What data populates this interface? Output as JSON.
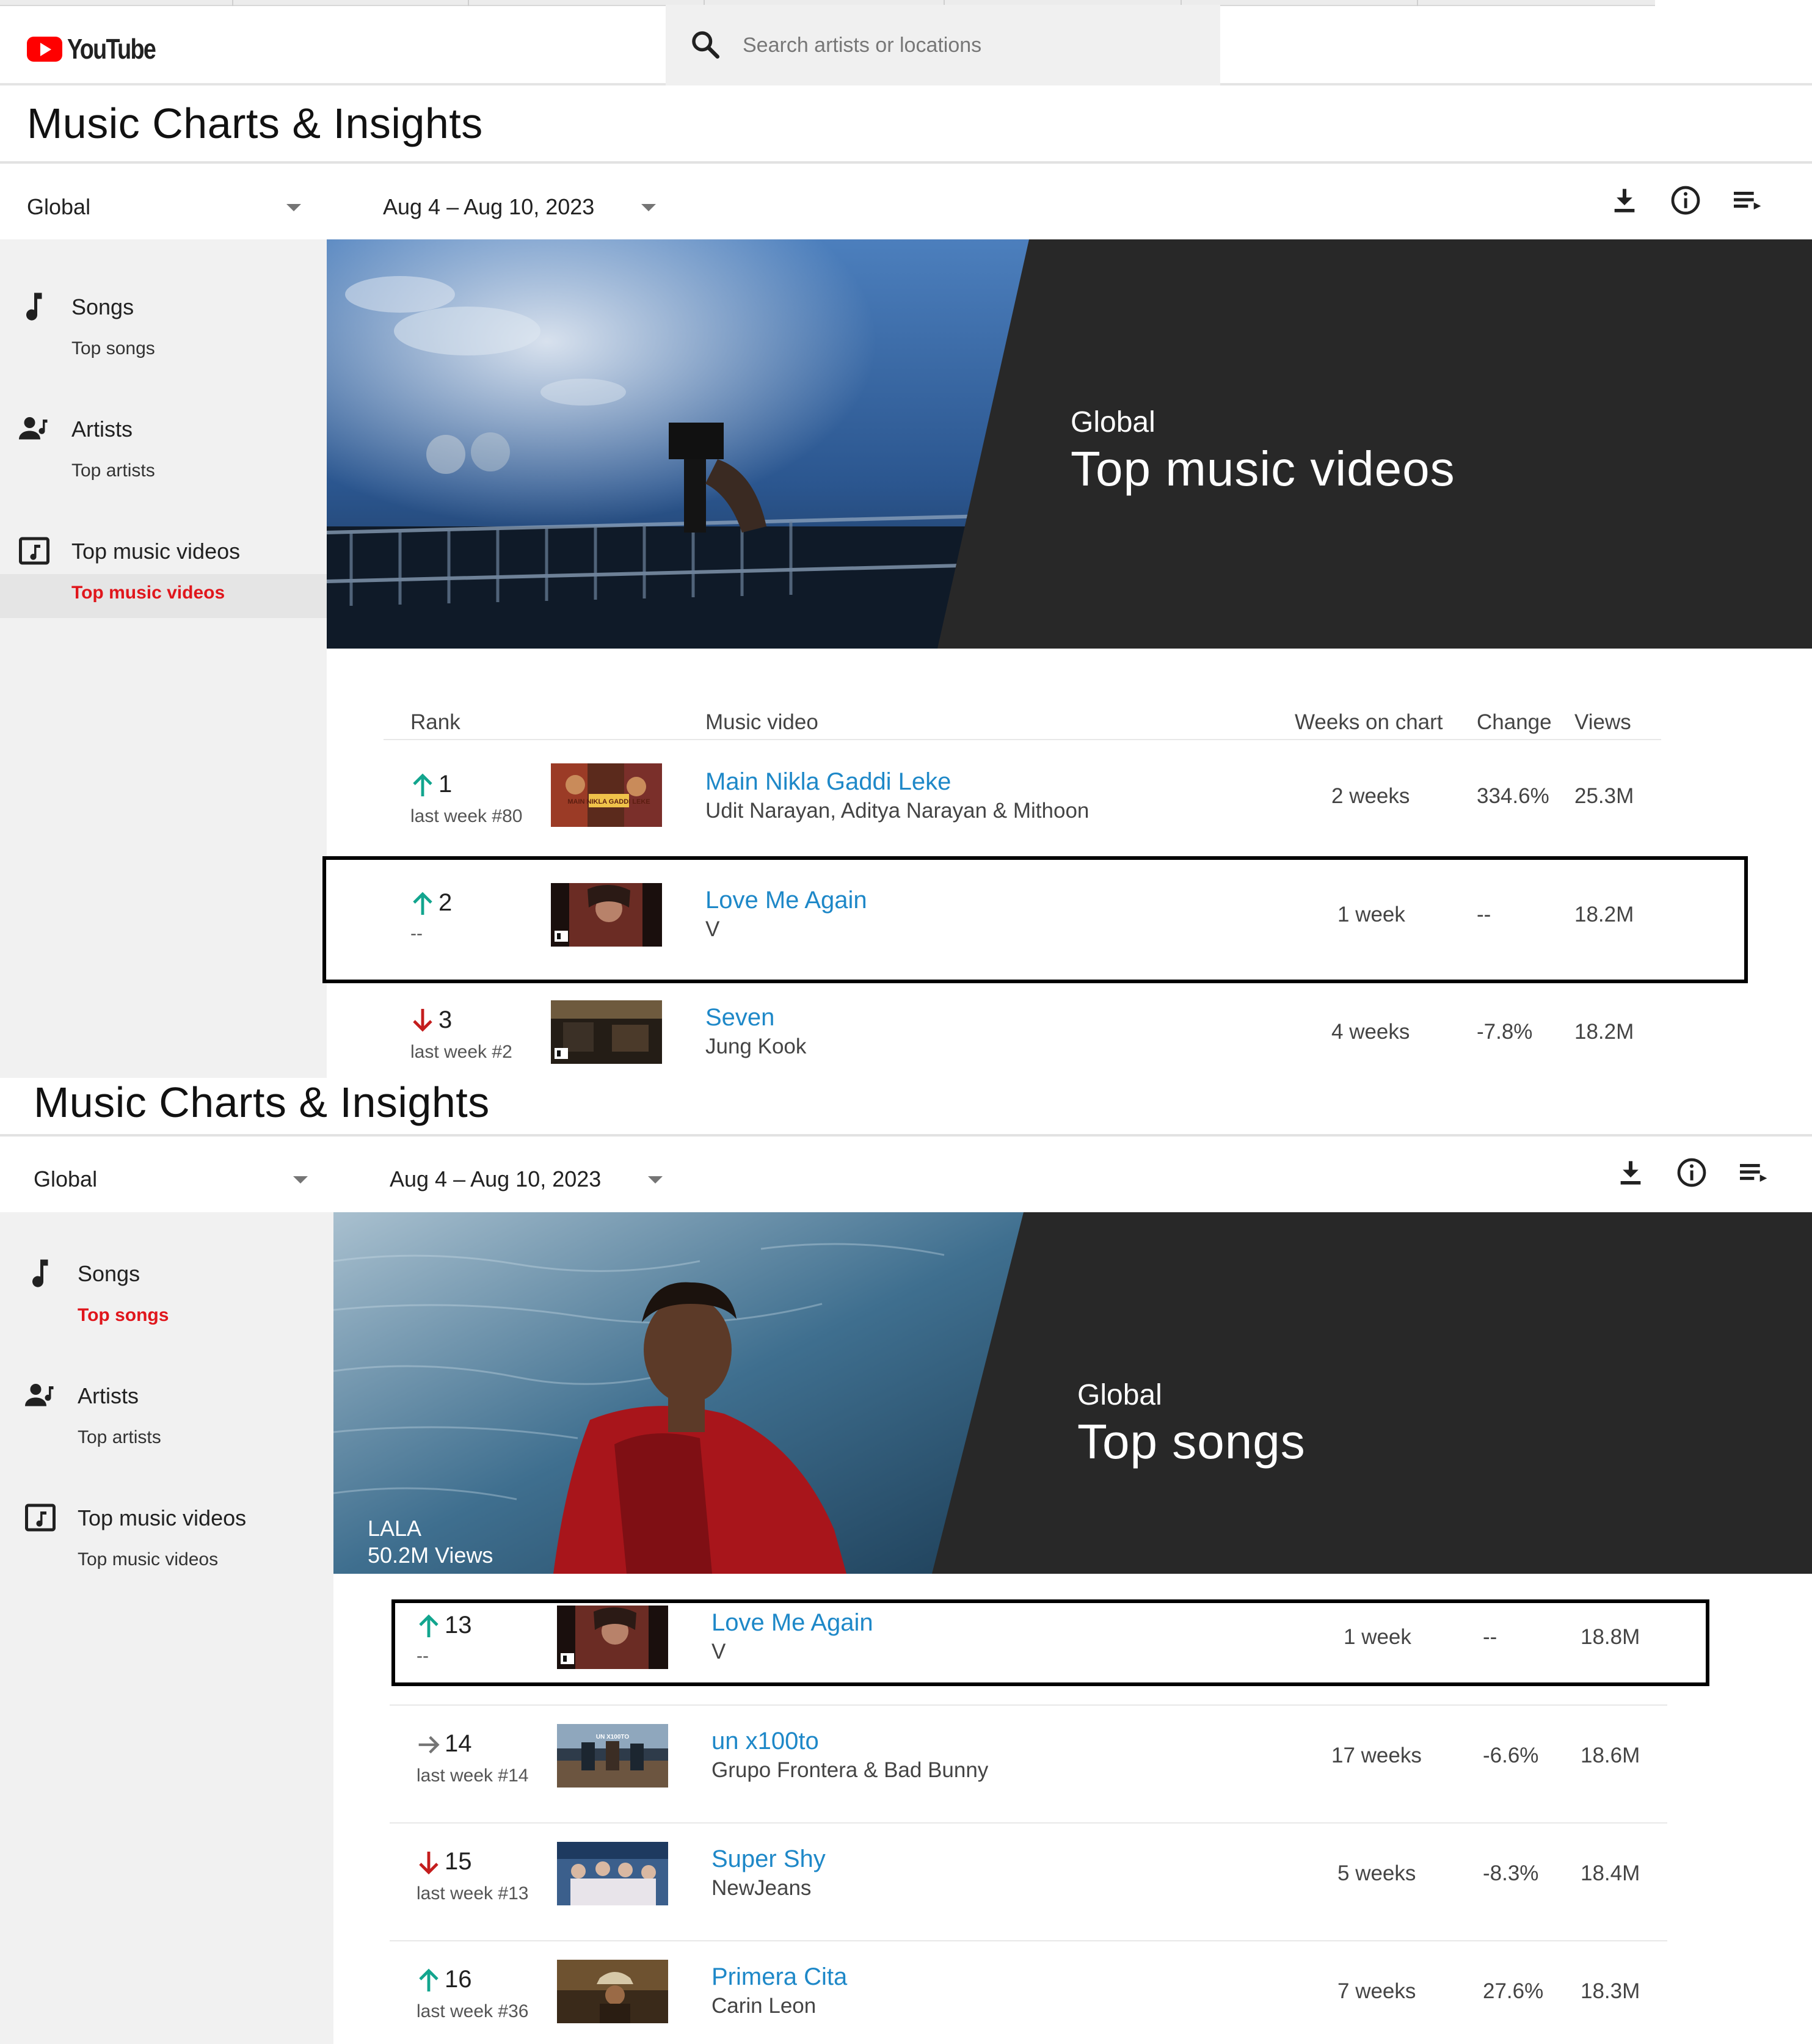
{
  "youtube_header": {
    "logo_text": "YouTube",
    "search_placeholder": "Search artists or locations"
  },
  "panels": [
    {
      "page_title": "Music Charts & Insights",
      "filters": {
        "region": "Global",
        "date_range": "Aug 4 – Aug 10, 2023"
      },
      "toolbar": [
        "download-icon",
        "info-icon",
        "playlist-icon"
      ],
      "sidebar": [
        {
          "title": "Songs",
          "sub": "Top songs",
          "icon": "music-note-icon",
          "active": false
        },
        {
          "title": "Artists",
          "sub": "Top artists",
          "icon": "artist-icon",
          "active": false
        },
        {
          "title": "Top music videos",
          "sub": "Top music videos",
          "icon": "music-video-icon",
          "active": true
        }
      ],
      "banner": {
        "kicker": "Global",
        "title": "Top music videos"
      },
      "table_headers": {
        "rank": "Rank",
        "video": "Music video",
        "weeks": "Weeks on chart",
        "change": "Change",
        "views": "Views"
      },
      "rows": [
        {
          "trend": "up",
          "rank": "1",
          "last_week": "last week #80",
          "title": "Main Nikla Gaddi Leke",
          "artist": "Udit Narayan, Aditya Narayan & Mithoon",
          "weeks": "2 weeks",
          "change": "334.6%",
          "views": "25.3M",
          "thumb_text": "MAIN NIKLA GADDI LEKE",
          "highlighted": false
        },
        {
          "trend": "up",
          "rank": "2",
          "last_week": "--",
          "title": "Love Me Again",
          "artist": "V",
          "weeks": "1 week",
          "change": "--",
          "views": "18.2M",
          "highlighted": true
        },
        {
          "trend": "down",
          "rank": "3",
          "last_week": "last week #2",
          "title": "Seven",
          "artist": "Jung Kook",
          "weeks": "4 weeks",
          "change": "-7.8%",
          "views": "18.2M",
          "highlighted": false
        }
      ]
    },
    {
      "page_title": "Music Charts & Insights",
      "filters": {
        "region": "Global",
        "date_range": "Aug 4 – Aug 10, 2023"
      },
      "toolbar": [
        "download-icon",
        "info-icon",
        "playlist-icon"
      ],
      "sidebar": [
        {
          "title": "Songs",
          "sub": "Top songs",
          "icon": "music-note-icon",
          "active": true
        },
        {
          "title": "Artists",
          "sub": "Top artists",
          "icon": "artist-icon",
          "active": false
        },
        {
          "title": "Top music videos",
          "sub": "Top music videos",
          "icon": "music-video-icon",
          "active": false
        }
      ],
      "banner": {
        "kicker": "Global",
        "title": "Top songs",
        "feature_song": "LALA",
        "feature_views": "50.2M Views"
      },
      "rows": [
        {
          "trend": "up",
          "rank": "13",
          "last_week": "--",
          "title": "Love Me Again",
          "artist": "V",
          "weeks": "1 week",
          "change": "--",
          "views": "18.8M",
          "highlighted": true
        },
        {
          "trend": "same",
          "rank": "14",
          "last_week": "last week #14",
          "title": "un x100to",
          "artist": "Grupo Frontera & Bad Bunny",
          "weeks": "17 weeks",
          "change": "-6.6%",
          "views": "18.6M",
          "highlighted": false
        },
        {
          "trend": "down",
          "rank": "15",
          "last_week": "last week #13",
          "title": "Super Shy",
          "artist": "NewJeans",
          "weeks": "5 weeks",
          "change": "-8.3%",
          "views": "18.4M",
          "highlighted": false
        },
        {
          "trend": "up",
          "rank": "16",
          "last_week": "last week #36",
          "title": "Primera Cita",
          "artist": "Carin Leon",
          "weeks": "7 weeks",
          "change": "27.6%",
          "views": "18.3M",
          "highlighted": false
        }
      ]
    }
  ],
  "colors": {
    "brand_red": "#ff0000",
    "active_nav": "#e0161c",
    "link_blue": "#1e88c8",
    "trend_up": "#12a58e",
    "trend_down": "#c41d1d",
    "trend_same": "#757575",
    "banner_bg": "#282828"
  }
}
